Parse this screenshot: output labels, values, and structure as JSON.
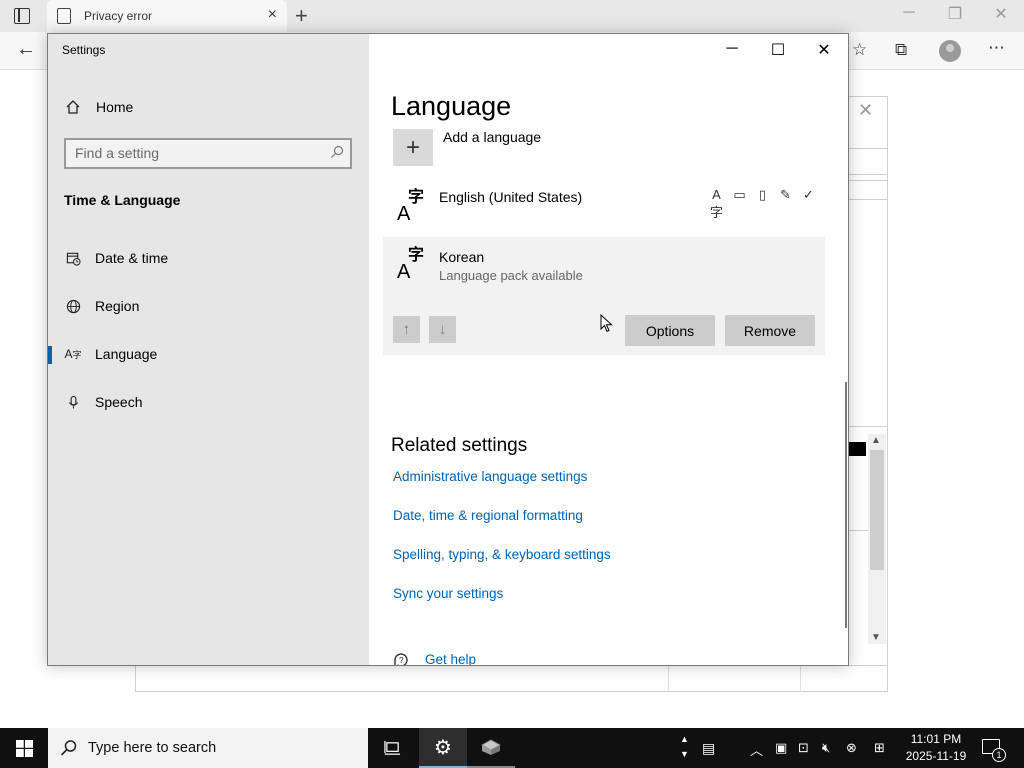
{
  "browser": {
    "tab_title": "Privacy error",
    "icons": [
      "tab-actions-icon",
      "page-icon",
      "close-icon",
      "plus-icon",
      "back-arrow-icon",
      "favorites-star-icon",
      "collections-icon",
      "profile-icon",
      "more-icon"
    ]
  },
  "settings": {
    "window_title": "Settings",
    "home_label": "Home",
    "search_placeholder": "Find a setting",
    "section_title": "Time & Language",
    "nav": [
      {
        "label": "Date & time",
        "icon": "calendar-clock-icon"
      },
      {
        "label": "Region",
        "icon": "globe-icon"
      },
      {
        "label": "Language",
        "icon": "language-icon",
        "active": true
      },
      {
        "label": "Speech",
        "icon": "microphone-icon"
      }
    ],
    "page_title": "Language",
    "add_language_label": "Add a language",
    "languages": [
      {
        "name": "English (United States)",
        "sublabel": "",
        "features": [
          "display-language-icon",
          "text-to-speech-icon",
          "speech-recognition-icon",
          "handwriting-icon",
          "spell-check-icon"
        ]
      },
      {
        "name": "Korean",
        "sublabel": "Language pack available"
      }
    ],
    "options_label": "Options",
    "remove_label": "Remove",
    "related_title": "Related settings",
    "related_links": [
      "Administrative language settings",
      "Date, time & regional formatting",
      "Spelling, typing, & keyboard settings",
      "Sync your settings"
    ],
    "get_help": "Get help",
    "accent_color": "#0063b1"
  },
  "taskbar": {
    "search_placeholder": "Type here to search",
    "time": "11:01 PM",
    "date": "2025-11-19",
    "notification_count": "1"
  }
}
